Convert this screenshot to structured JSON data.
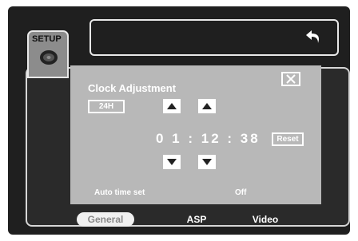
{
  "header": {
    "setup_label": "SETUP"
  },
  "clock": {
    "title": "Clock Adjustment",
    "mode_label": "24H",
    "time": "0 1 : 12 : 38",
    "reset_label": "Reset",
    "auto_time_label": "Auto time set",
    "auto_time_value": "Off"
  },
  "tabs": [
    {
      "label": "General",
      "active": true
    },
    {
      "label": "ASP",
      "active": false
    },
    {
      "label": "Video",
      "active": false
    }
  ],
  "colors": {
    "panel": "#b8b8b8",
    "background": "#1f1f1f",
    "border": "#e8e8e8"
  },
  "icons": [
    "disc-icon",
    "back-arrow-icon",
    "close-icon",
    "up-arrow-icon",
    "down-arrow-icon"
  ]
}
